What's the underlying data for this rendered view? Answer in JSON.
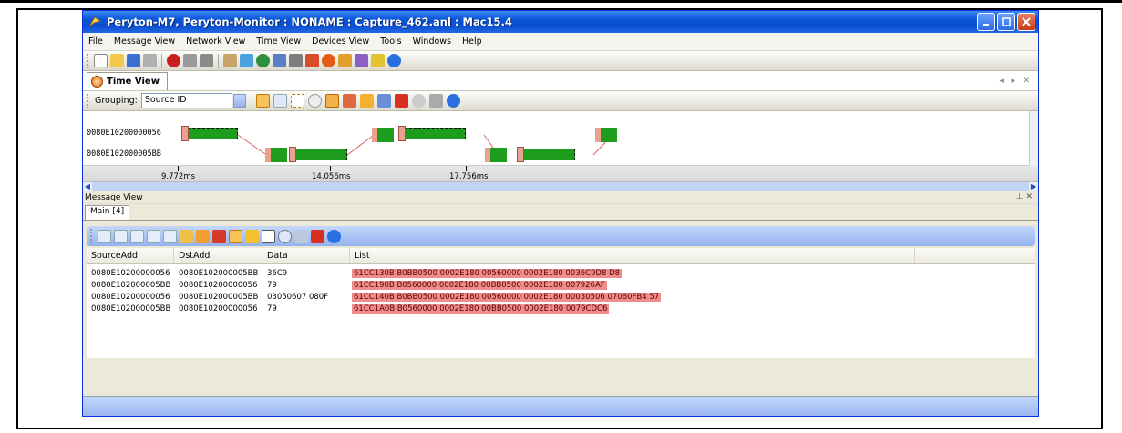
{
  "window": {
    "title": "Peryton-M7, Peryton-Monitor : NONAME : Capture_462.anl : Mac15.4",
    "controls": [
      "minimize-icon",
      "maximize-icon",
      "close-icon"
    ]
  },
  "menu": {
    "items": [
      "File",
      "Message View",
      "Network View",
      "Time View",
      "Devices View",
      "Tools",
      "Windows",
      "Help"
    ]
  },
  "time_view": {
    "tab_label": "Time View",
    "grouping_label": "Grouping:",
    "grouping_value": "Source ID",
    "rows": [
      "0080E10200000056",
      "0080E102000005BB"
    ],
    "ticks": [
      "9.772ms",
      "14.056ms",
      "17.756ms"
    ]
  },
  "message_view": {
    "panel_title": "Message View",
    "tab_label": "Main [4]",
    "columns": [
      "SourceAdd",
      "DstAdd",
      "Data",
      "List"
    ],
    "rows": [
      [
        "0080E10200000056",
        "0080E102000005BB",
        "36C9",
        "61CC130B B0BB0500 0002E180 00560000 0002E180 0036C9D8 D8"
      ],
      [
        "0080E102000005BB",
        "0080E10200000056",
        "79",
        "61CC190B B0560000 0002E180 00BB0500 0002E180 007926AF"
      ],
      [
        "0080E10200000056",
        "0080E102000005BB",
        "03050607 080F",
        "61CC140B B0BB0500 0002E180 00560000 0002E180 00030506 07080FB4 57"
      ],
      [
        "0080E102000005BB",
        "0080E10200000056",
        "79",
        "61CC1A0B B0560000 0002E180 00BB0500 0002E180 0079CDC6"
      ]
    ]
  },
  "colors": {
    "titlebar": "#0a53d6",
    "segment": "#1e9c1e",
    "list_highlight": "#f08c8c"
  }
}
